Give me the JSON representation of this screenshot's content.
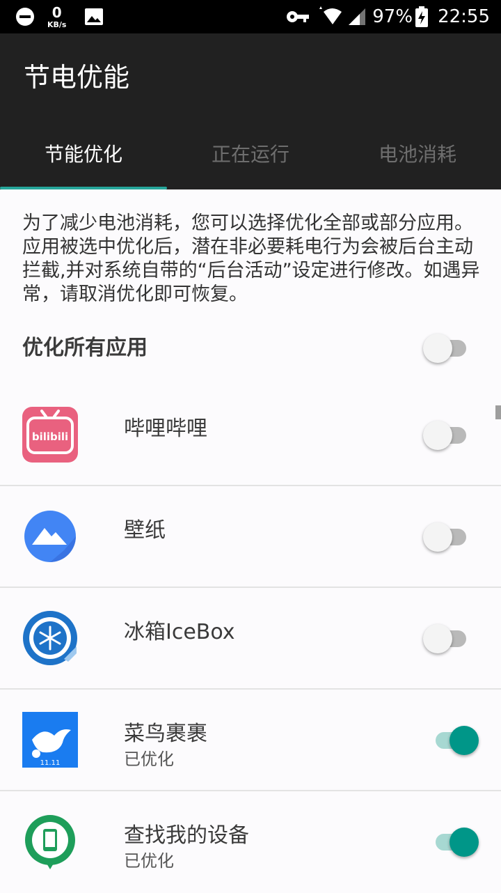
{
  "status_bar": {
    "net_speed_value": "0",
    "net_speed_unit": "KB/s",
    "battery_percent": "97%",
    "time": "22:55",
    "icons": [
      "dnd-icon",
      "image-icon",
      "vpn-key-icon",
      "wifi-icon",
      "signal-icon",
      "battery-charging-icon"
    ]
  },
  "app_bar": {
    "title": "节电优能"
  },
  "tabs": [
    {
      "label": "节能优化",
      "active": true
    },
    {
      "label": "正在运行",
      "active": false
    },
    {
      "label": "电池消耗",
      "active": false
    }
  ],
  "description": "为了减少电池消耗，您可以选择优化全部或部分应用。应用被选中优化后，潜在非必要耗电行为会被后台主动拦截,并对系统自带的“后台活动”设定进行修改。如遇异常，请取消优化即可恢复。",
  "optimize_all": {
    "label": "优化所有应用",
    "enabled": false
  },
  "apps": [
    {
      "name": "哔哩哔哩",
      "status": "",
      "icon": "bilibili-icon",
      "icon_text": "bilibili",
      "optimized": false
    },
    {
      "name": "壁纸",
      "status": "",
      "icon": "wallpaper-icon",
      "optimized": false
    },
    {
      "name": "冰箱IceBox",
      "status": "",
      "icon": "icebox-icon",
      "optimized": false
    },
    {
      "name": "菜鸟裹裹",
      "status": "已优化",
      "icon": "cainiao-icon",
      "icon_text": "11.11",
      "optimized": true
    },
    {
      "name": "查找我的设备",
      "status": "已优化",
      "icon": "find-my-device-icon",
      "optimized": true
    }
  ],
  "colors": {
    "app_bar": "#212121",
    "accent": "#009688",
    "tab_indicator": "#26a69a",
    "background": "#fcfbfd"
  }
}
